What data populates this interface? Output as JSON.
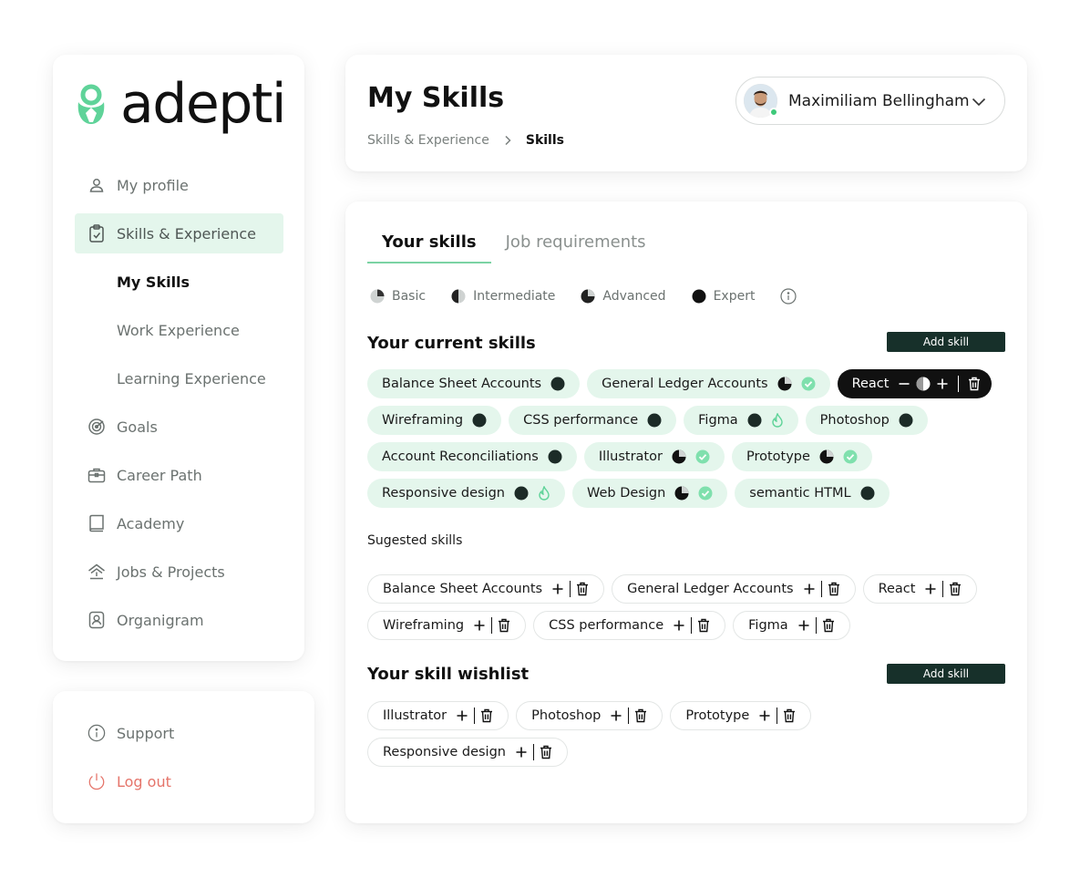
{
  "app": {
    "brand": "adepti"
  },
  "sidebar": {
    "items": [
      {
        "label": "My profile",
        "icon": "user-icon"
      },
      {
        "label": "Skills & Experience",
        "icon": "clipboard-check-icon",
        "active": true
      },
      {
        "label": "My Skills",
        "sub": true,
        "current": true
      },
      {
        "label": "Work Experience",
        "sub": true
      },
      {
        "label": "Learning Experience",
        "sub": true
      },
      {
        "label": "Goals",
        "icon": "target-icon"
      },
      {
        "label": "Career Path",
        "icon": "briefcase-icon"
      },
      {
        "label": "Academy",
        "icon": "book-icon"
      },
      {
        "label": "Jobs & Projects",
        "icon": "house-up-icon"
      },
      {
        "label": "Organigram",
        "icon": "id-badge-icon"
      }
    ],
    "bottom": [
      {
        "label": "Support",
        "icon": "info-icon"
      },
      {
        "label": "Log out",
        "icon": "power-icon"
      }
    ]
  },
  "header": {
    "title": "My Skills",
    "breadcrumb": [
      "Skills & Experience",
      "Skills"
    ],
    "user": {
      "name": "Maximiliam Bellingham",
      "status": "online"
    }
  },
  "tabs": [
    "Your skills",
    "Job requirements"
  ],
  "legend": [
    "Basic",
    "Intermediate",
    "Advanced",
    "Expert"
  ],
  "current_skills": {
    "title": "Your current skills",
    "add_label": "Add skill",
    "react": "React",
    "skills": [
      {
        "name": "Balance Sheet Accounts",
        "level": "expert"
      },
      {
        "name": "General Ledger Accounts",
        "level": "advanced",
        "badge": "check"
      },
      {
        "name": "Wireframing",
        "level": "expert"
      },
      {
        "name": "CSS performance",
        "level": "expert"
      },
      {
        "name": "Figma",
        "level": "expert",
        "badge": "flame"
      },
      {
        "name": "Photoshop",
        "level": "expert"
      },
      {
        "name": "Account Reconciliations",
        "level": "expert"
      },
      {
        "name": "Illustrator",
        "level": "advanced",
        "badge": "check"
      },
      {
        "name": "Prototype",
        "level": "advanced",
        "badge": "check"
      },
      {
        "name": "Responsive design",
        "level": "expert",
        "badge": "flame"
      },
      {
        "name": "Web Design",
        "level": "advanced",
        "badge": "check"
      },
      {
        "name": "semantic HTML",
        "level": "expert"
      }
    ]
  },
  "suggested": {
    "title": "Sugested skills",
    "skills": [
      "Balance Sheet Accounts",
      "General Ledger Accounts",
      "React",
      "Wireframing",
      "CSS performance",
      "Figma"
    ]
  },
  "wishlist": {
    "title": "Your skill wishlist",
    "add_label": "Add skill",
    "skills": [
      "Illustrator",
      "Photoshop",
      "Prototype",
      "Responsive design"
    ]
  },
  "colors": {
    "accent": "#e4f6ec",
    "dark_button": "#17302a",
    "check": "#5fd399",
    "logout": "#e5746a"
  }
}
